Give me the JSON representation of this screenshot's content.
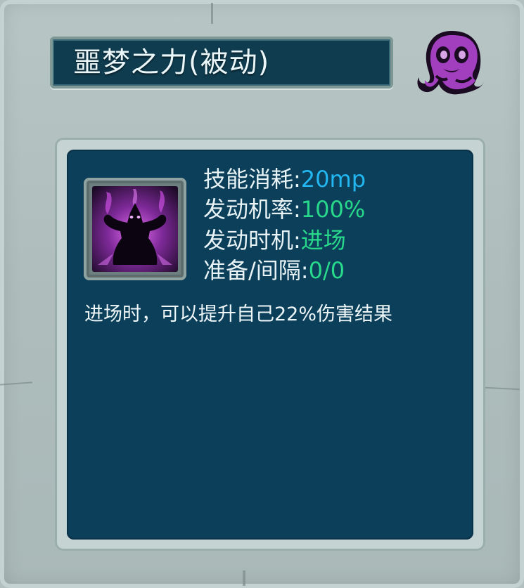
{
  "skill": {
    "title": "噩梦之力(被动)",
    "stats": [
      {
        "label": "技能消耗:",
        "value": "20mp",
        "value_color": "#22b7f0"
      },
      {
        "label": "发动机率:",
        "value": "100%",
        "value_color": "#29d98b"
      },
      {
        "label": "发动时机:",
        "value": "进场",
        "value_color": "#29d98b"
      },
      {
        "label": "准备/间隔:",
        "value": "0/0",
        "value_color": "#29d98b"
      }
    ],
    "description": "进场时，可以提升自己22%伤害结果",
    "icon": "dark-demon-purple-flames-icon",
    "badge_icon": "purple-ghost-icon"
  },
  "colors": {
    "panel_bg": "#b2c1c0",
    "content_bg": "#0b3f5a",
    "title_bg": "#0f3c4f",
    "accent_cyan": "#22b7f0",
    "accent_green": "#29d98b",
    "purple": "#a23fbf"
  }
}
